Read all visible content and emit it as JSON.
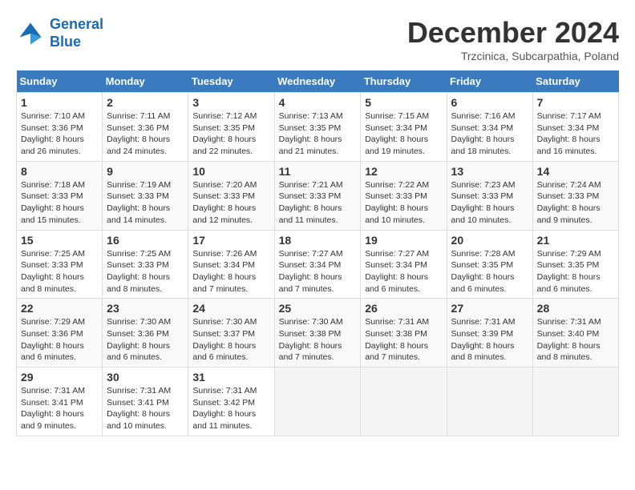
{
  "header": {
    "logo_line1": "General",
    "logo_line2": "Blue",
    "month_title": "December 2024",
    "location": "Trzcinica, Subcarpathia, Poland"
  },
  "days_of_week": [
    "Sunday",
    "Monday",
    "Tuesday",
    "Wednesday",
    "Thursday",
    "Friday",
    "Saturday"
  ],
  "weeks": [
    [
      {
        "day": "1",
        "sunrise": "7:10 AM",
        "sunset": "3:36 PM",
        "daylight": "8 hours and 26 minutes."
      },
      {
        "day": "2",
        "sunrise": "7:11 AM",
        "sunset": "3:36 PM",
        "daylight": "8 hours and 24 minutes."
      },
      {
        "day": "3",
        "sunrise": "7:12 AM",
        "sunset": "3:35 PM",
        "daylight": "8 hours and 22 minutes."
      },
      {
        "day": "4",
        "sunrise": "7:13 AM",
        "sunset": "3:35 PM",
        "daylight": "8 hours and 21 minutes."
      },
      {
        "day": "5",
        "sunrise": "7:15 AM",
        "sunset": "3:34 PM",
        "daylight": "8 hours and 19 minutes."
      },
      {
        "day": "6",
        "sunrise": "7:16 AM",
        "sunset": "3:34 PM",
        "daylight": "8 hours and 18 minutes."
      },
      {
        "day": "7",
        "sunrise": "7:17 AM",
        "sunset": "3:34 PM",
        "daylight": "8 hours and 16 minutes."
      }
    ],
    [
      {
        "day": "8",
        "sunrise": "7:18 AM",
        "sunset": "3:33 PM",
        "daylight": "8 hours and 15 minutes."
      },
      {
        "day": "9",
        "sunrise": "7:19 AM",
        "sunset": "3:33 PM",
        "daylight": "8 hours and 14 minutes."
      },
      {
        "day": "10",
        "sunrise": "7:20 AM",
        "sunset": "3:33 PM",
        "daylight": "8 hours and 12 minutes."
      },
      {
        "day": "11",
        "sunrise": "7:21 AM",
        "sunset": "3:33 PM",
        "daylight": "8 hours and 11 minutes."
      },
      {
        "day": "12",
        "sunrise": "7:22 AM",
        "sunset": "3:33 PM",
        "daylight": "8 hours and 10 minutes."
      },
      {
        "day": "13",
        "sunrise": "7:23 AM",
        "sunset": "3:33 PM",
        "daylight": "8 hours and 10 minutes."
      },
      {
        "day": "14",
        "sunrise": "7:24 AM",
        "sunset": "3:33 PM",
        "daylight": "8 hours and 9 minutes."
      }
    ],
    [
      {
        "day": "15",
        "sunrise": "7:25 AM",
        "sunset": "3:33 PM",
        "daylight": "8 hours and 8 minutes."
      },
      {
        "day": "16",
        "sunrise": "7:25 AM",
        "sunset": "3:33 PM",
        "daylight": "8 hours and 8 minutes."
      },
      {
        "day": "17",
        "sunrise": "7:26 AM",
        "sunset": "3:34 PM",
        "daylight": "8 hours and 7 minutes."
      },
      {
        "day": "18",
        "sunrise": "7:27 AM",
        "sunset": "3:34 PM",
        "daylight": "8 hours and 7 minutes."
      },
      {
        "day": "19",
        "sunrise": "7:27 AM",
        "sunset": "3:34 PM",
        "daylight": "8 hours and 6 minutes."
      },
      {
        "day": "20",
        "sunrise": "7:28 AM",
        "sunset": "3:35 PM",
        "daylight": "8 hours and 6 minutes."
      },
      {
        "day": "21",
        "sunrise": "7:29 AM",
        "sunset": "3:35 PM",
        "daylight": "8 hours and 6 minutes."
      }
    ],
    [
      {
        "day": "22",
        "sunrise": "7:29 AM",
        "sunset": "3:36 PM",
        "daylight": "8 hours and 6 minutes."
      },
      {
        "day": "23",
        "sunrise": "7:30 AM",
        "sunset": "3:36 PM",
        "daylight": "8 hours and 6 minutes."
      },
      {
        "day": "24",
        "sunrise": "7:30 AM",
        "sunset": "3:37 PM",
        "daylight": "8 hours and 6 minutes."
      },
      {
        "day": "25",
        "sunrise": "7:30 AM",
        "sunset": "3:38 PM",
        "daylight": "8 hours and 7 minutes."
      },
      {
        "day": "26",
        "sunrise": "7:31 AM",
        "sunset": "3:38 PM",
        "daylight": "8 hours and 7 minutes."
      },
      {
        "day": "27",
        "sunrise": "7:31 AM",
        "sunset": "3:39 PM",
        "daylight": "8 hours and 8 minutes."
      },
      {
        "day": "28",
        "sunrise": "7:31 AM",
        "sunset": "3:40 PM",
        "daylight": "8 hours and 8 minutes."
      }
    ],
    [
      {
        "day": "29",
        "sunrise": "7:31 AM",
        "sunset": "3:41 PM",
        "daylight": "8 hours and 9 minutes."
      },
      {
        "day": "30",
        "sunrise": "7:31 AM",
        "sunset": "3:41 PM",
        "daylight": "8 hours and 10 minutes."
      },
      {
        "day": "31",
        "sunrise": "7:31 AM",
        "sunset": "3:42 PM",
        "daylight": "8 hours and 11 minutes."
      },
      null,
      null,
      null,
      null
    ]
  ]
}
